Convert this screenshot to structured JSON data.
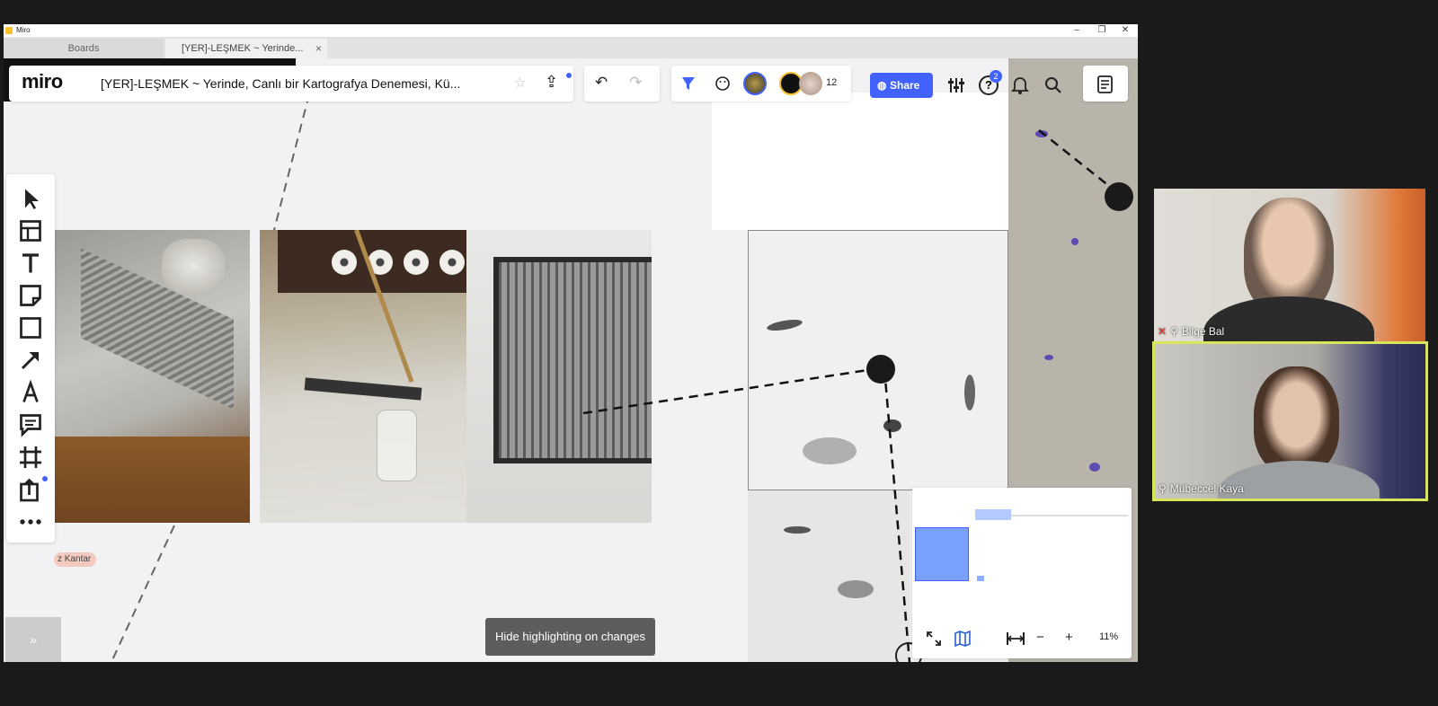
{
  "window": {
    "app_title": "Miro",
    "controls": {
      "minimize": "–",
      "maximize": "❐",
      "close": "✕"
    }
  },
  "tabs": [
    {
      "label": "Boards"
    },
    {
      "label": "[YER]-LEŞMEK ~ Yerinde...",
      "close": "×"
    }
  ],
  "header": {
    "logo": "miro",
    "board_title": "[YER]-LEŞMEK ~ Yerinde, Canlı bir Kartografya Denemesi, Kü...",
    "star": "☆",
    "export": "⇪"
  },
  "undo_bar": {
    "undo": "↶",
    "redo": "↷"
  },
  "collab": {
    "participant_count": "12",
    "share_label": "Share",
    "help_badge": "2"
  },
  "toolbar": {
    "items": [
      "select",
      "templates",
      "text",
      "sticky-note",
      "shape",
      "arrow",
      "pen",
      "comment",
      "frame",
      "upload",
      "more"
    ]
  },
  "canvas": {
    "name_label": "z Kantar"
  },
  "hide_button": {
    "label": "Hide highlighting on changes"
  },
  "expander": {
    "label": "»"
  },
  "minimap": {
    "zoom": "11%"
  },
  "participants": [
    {
      "name": "Bilge Bal"
    },
    {
      "name": "Mübeccel Kaya"
    }
  ],
  "colors": {
    "accent": "#4262ff",
    "active_speaker_border": "#d8e55a",
    "hide_button_bg": "#5d5d5d"
  }
}
